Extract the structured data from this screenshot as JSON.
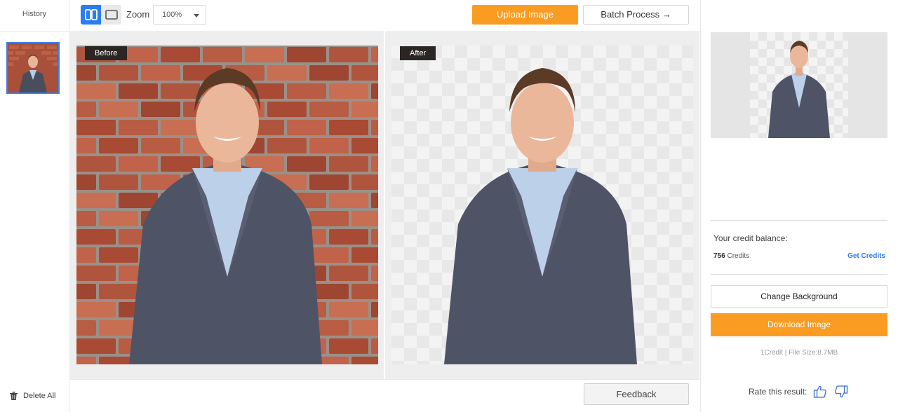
{
  "history": {
    "title": "History",
    "delete_all_label": "Delete All",
    "delete_icon": "trash-icon"
  },
  "toolbar": {
    "view_split_icon": "split-view-icon",
    "view_single_icon": "single-view-icon",
    "zoom_label": "Zoom",
    "zoom_value": "100%",
    "upload_label": "Upload Image",
    "batch_label": "Batch Process →"
  },
  "canvas": {
    "before_tag": "Before",
    "after_tag": "After"
  },
  "bottom": {
    "feedback_label": "Feedback"
  },
  "sidebar": {
    "credit_label": "Your credit balance:",
    "credit_count": "756",
    "credit_unit": " Credits",
    "get_credits_label": "Get Credits",
    "change_bg_label": "Change Background",
    "download_label": "Download Image",
    "file_info": "1Credit | File Size:8.7MB",
    "rate_label": "Rate this result:"
  },
  "colors": {
    "accent_orange": "#fb9c22",
    "accent_blue": "#2a7cf0",
    "tag_bg": "#2b2624"
  }
}
